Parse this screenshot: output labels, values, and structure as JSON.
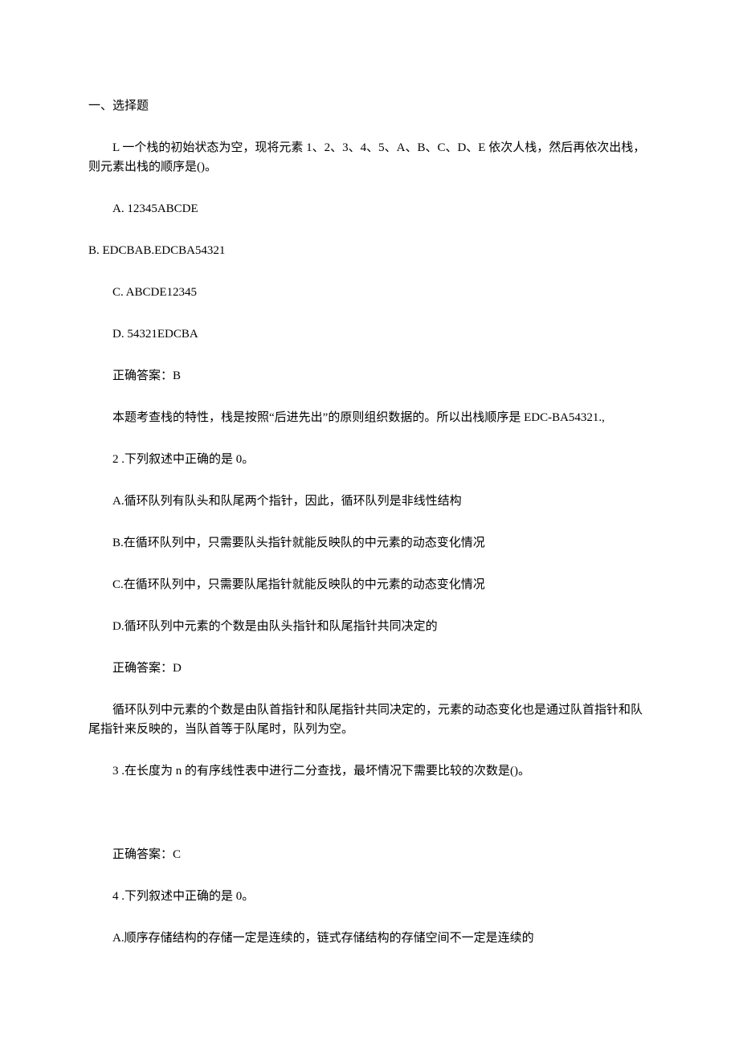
{
  "section_title": "一、选择题",
  "q1": {
    "stem": "L 一个栈的初始状态为空，现将元素 1、2、3、4、5、A、B、C、D、E 依次人栈，然后再依次出栈，则元素出栈的顺序是()。",
    "opt_a": "A.  12345ABCDE",
    "opt_b": "B.  EDCBAB.EDCBA54321",
    "opt_c": "C.  ABCDE12345",
    "opt_d": "D.  54321EDCBA",
    "answer": "正确答案：B",
    "explain": "本题考查栈的特性，栈是按照“后进先出”的原则组织数据的。所以出栈顺序是 EDC-BA54321.,"
  },
  "q2": {
    "stem": "2 .下列叙述中正确的是 0。",
    "opt_a": "A.循环队列有队头和队尾两个指针，因此，循环队列是非线性结构",
    "opt_b": "B.在循环队列中，只需要队头指针就能反映队的中元素的动态变化情况",
    "opt_c": "C.在循环队列中，只需要队尾指针就能反映队的中元素的动态变化情况",
    "opt_d": "D.循环队列中元素的个数是由队头指针和队尾指针共同决定的",
    "answer": "正确答案：D",
    "explain": "循环队列中元素的个数是由队首指针和队尾指针共同决定的，元素的动态变化也是通过队首指针和队尾指针来反映的，当队首等于队尾时，队列为空。"
  },
  "q3": {
    "stem": "3 .在长度为 n 的有序线性表中进行二分查找，最坏情况下需要比较的次数是()。",
    "answer": "正确答案：C"
  },
  "q4": {
    "stem": "4 .下列叙述中正确的是 0。",
    "opt_a": "A.顺序存储结构的存储一定是连续的，链式存储结构的存储空间不一定是连续的"
  }
}
